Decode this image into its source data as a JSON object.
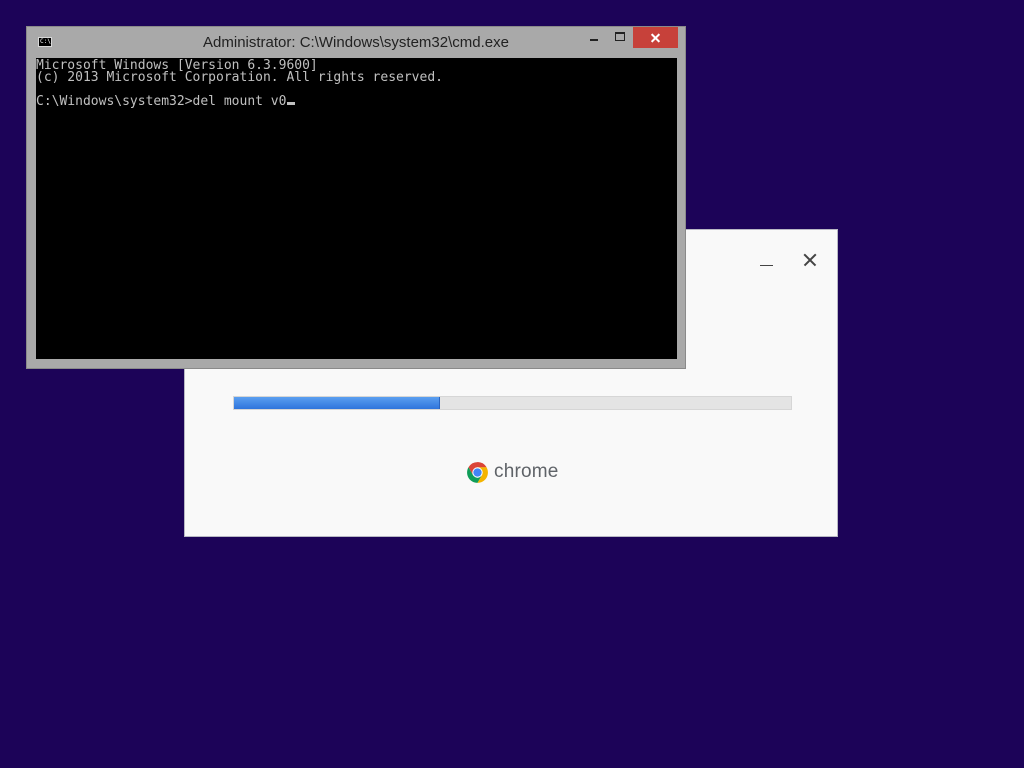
{
  "desktop": {
    "background_color": "#1c0358"
  },
  "installer": {
    "name": "chrome",
    "progress": 0.37,
    "progress_color": "#3b82e8",
    "minimize_icon": "minimize-icon",
    "close_icon": "close-icon",
    "logo_icon": "chrome-logo-icon"
  },
  "cmd": {
    "title": "Administrator: C:\\Windows\\system32\\cmd.exe",
    "app_icon": "cmd-icon",
    "buttons": {
      "minimize": "minimize-icon",
      "maximize": "maximize-icon",
      "close": "close-icon",
      "close_color": "#c7413a"
    },
    "console_lines": [
      "Microsoft Windows [Version 6.3.9600]",
      "(c) 2013 Microsoft Corporation. All rights reserved.",
      "C:\\Windows\\system32>del mount v0"
    ]
  }
}
